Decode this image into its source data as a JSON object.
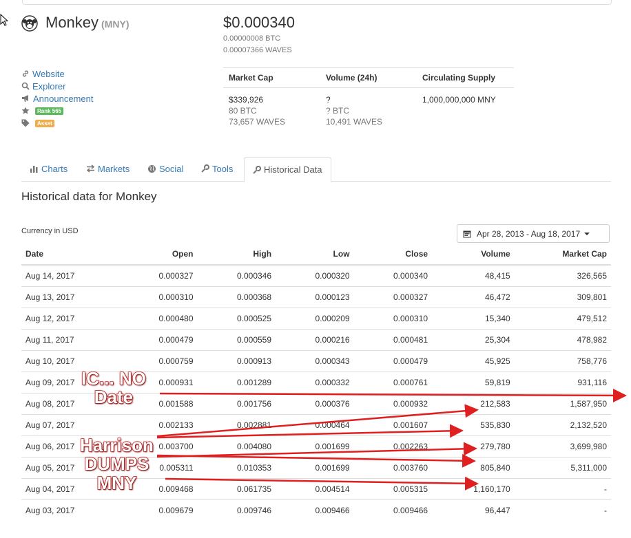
{
  "coin": {
    "name": "Monkey",
    "symbol": "(MNY)",
    "price_usd": "$0.000340",
    "price_btc": "0.00000008 BTC",
    "price_waves": "0.00007366 WAVES"
  },
  "links": [
    {
      "label": "Website",
      "icon": "link-icon"
    },
    {
      "label": "Explorer",
      "icon": "search-icon"
    },
    {
      "label": "Announcement",
      "icon": "bullhorn-icon"
    }
  ],
  "badges": {
    "rank": {
      "label": "Rank 565",
      "color": "#5cb85c",
      "icon": "star-icon"
    },
    "type": {
      "label": "Asset",
      "color": "#f0ad4e",
      "icon": "tag-icon"
    }
  },
  "stats": {
    "headers": [
      "Market Cap",
      "Volume (24h)",
      "Circulating Supply"
    ],
    "market_cap": [
      "$339,926",
      "80 BTC",
      "73,657 WAVES"
    ],
    "volume": [
      "?",
      "? BTC",
      "10,491 WAVES"
    ],
    "supply": [
      "1,000,000,000 MNY"
    ]
  },
  "tabs": [
    {
      "label": "Charts",
      "icon": "bar-chart-icon"
    },
    {
      "label": "Markets",
      "icon": "exchange-icon"
    },
    {
      "label": "Social",
      "icon": "globe-icon"
    },
    {
      "label": "Tools",
      "icon": "wrench-icon"
    },
    {
      "label": "Historical Data",
      "icon": "wrench-icon",
      "active": true
    }
  ],
  "historical": {
    "title": "Historical data for Monkey",
    "currency_label": "Currency in USD",
    "date_range": "Apr 28, 2013 - Aug 18, 2017",
    "columns": [
      "Date",
      "Open",
      "High",
      "Low",
      "Close",
      "Volume",
      "Market Cap"
    ],
    "rows": [
      [
        "Aug 14, 2017",
        "0.000327",
        "0.000346",
        "0.000320",
        "0.000340",
        "48,415",
        "326,565"
      ],
      [
        "Aug 13, 2017",
        "0.000310",
        "0.000368",
        "0.000123",
        "0.000327",
        "46,472",
        "309,801"
      ],
      [
        "Aug 12, 2017",
        "0.000480",
        "0.000525",
        "0.000209",
        "0.000310",
        "15,340",
        "479,512"
      ],
      [
        "Aug 11, 2017",
        "0.000479",
        "0.000559",
        "0.000216",
        "0.000481",
        "25,304",
        "478,982"
      ],
      [
        "Aug 10, 2017",
        "0.000759",
        "0.000913",
        "0.000343",
        "0.000479",
        "45,925",
        "758,776"
      ],
      [
        "Aug 09, 2017",
        "0.000931",
        "0.001289",
        "0.000332",
        "0.000761",
        "59,819",
        "931,116"
      ],
      [
        "Aug 08, 2017",
        "0.001588",
        "0.001756",
        "0.000376",
        "0.000932",
        "212,583",
        "1,587,950"
      ],
      [
        "Aug 07, 2017",
        "0.002133",
        "0.002881",
        "0.000464",
        "0.001607",
        "535,830",
        "2,132,520"
      ],
      [
        "Aug 06, 2017",
        "0.003700",
        "0.004080",
        "0.001699",
        "0.002263",
        "279,780",
        "3,699,980"
      ],
      [
        "Aug 05, 2017",
        "0.005311",
        "0.010353",
        "0.001699",
        "0.003760",
        "805,840",
        "5,311,000"
      ],
      [
        "Aug 04, 2017",
        "0.009468",
        "0.061735",
        "0.004514",
        "0.005315",
        "1,160,170",
        "-"
      ],
      [
        "Aug 03, 2017",
        "0.009679",
        "0.009746",
        "0.009466",
        "0.009466",
        "96,447",
        "-"
      ]
    ]
  },
  "annotations": {
    "ico": "IC... NO\nDate",
    "dump": "Harrison\nDUMPS\nMNY",
    "color": "#e02020"
  }
}
